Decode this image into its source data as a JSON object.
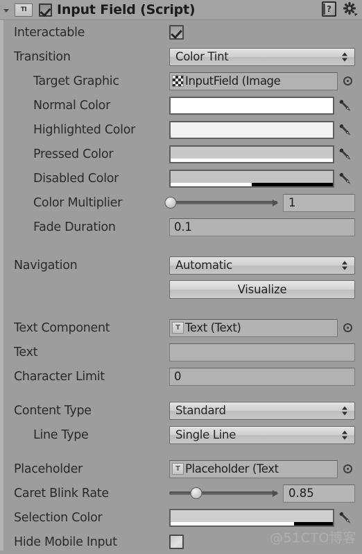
{
  "component": {
    "title": "Input Field (Script)",
    "script_icon_label": "TI",
    "enabled": true,
    "help_icon": "help-book-icon",
    "gear_icon": "gear-icon",
    "foldout_icon": "foldout-triangle-icon"
  },
  "rows": {
    "interactable": {
      "label": "Interactable",
      "checked": true
    },
    "transition": {
      "label": "Transition",
      "value": "Color Tint"
    },
    "target_graphic": {
      "label": "Target Graphic",
      "value": "InputField (Image",
      "icon": "image-component-icon",
      "picker": "object-picker-icon"
    },
    "normal_color": {
      "label": "Normal Color",
      "color": "#ffffff",
      "alpha": 100
    },
    "highlighted_color": {
      "label": "Highlighted Color",
      "color": "#f2f2f2",
      "alpha": 100
    },
    "pressed_color": {
      "label": "Pressed Color",
      "color": "#c8c8c8",
      "alpha": 100
    },
    "disabled_color": {
      "label": "Disabled Color",
      "color": "#c4c4c4",
      "alpha": 50
    },
    "color_multiplier": {
      "label": "Color Multiplier",
      "value": "1",
      "slider_pct": 1
    },
    "fade_duration": {
      "label": "Fade Duration",
      "value": "0.1"
    },
    "navigation": {
      "label": "Navigation",
      "value": "Automatic"
    },
    "visualize": {
      "label": "Visualize"
    },
    "text_component": {
      "label": "Text Component",
      "value": "Text (Text)",
      "icon": "text-component-icon",
      "picker": "object-picker-icon"
    },
    "text": {
      "label": "Text",
      "value": ""
    },
    "character_limit": {
      "label": "Character Limit",
      "value": "0"
    },
    "content_type": {
      "label": "Content Type",
      "value": "Standard"
    },
    "line_type": {
      "label": "Line Type",
      "value": "Single Line"
    },
    "placeholder": {
      "label": "Placeholder",
      "value": "Placeholder (Text",
      "icon": "text-component-icon",
      "picker": "object-picker-icon"
    },
    "caret_blink_rate": {
      "label": "Caret Blink Rate",
      "value": "0.85",
      "slider_pct": 25
    },
    "selection_color": {
      "label": "Selection Color",
      "color": "#cfcfcf",
      "alpha": 76
    },
    "hide_mobile_input": {
      "label": "Hide Mobile Input",
      "checked": false
    }
  },
  "watermark": {
    "text": "@51CTO博客"
  },
  "colors": {
    "panel_bg": "#9d9d9d",
    "header_bg": "#a3a3a3",
    "field_bg": "#b2b2b2",
    "text": "#2a2a2a"
  }
}
